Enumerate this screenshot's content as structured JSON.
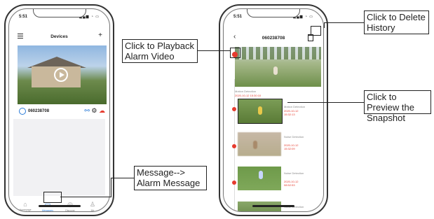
{
  "left_phone": {
    "status_time": "5:51",
    "title": "Devices",
    "device_id": "060238708",
    "tabs": [
      {
        "label": "Homepage",
        "icon": "home-icon"
      },
      {
        "label": "Messages",
        "icon": "message-icon"
      },
      {
        "label": "Discover",
        "icon": "compass-icon"
      },
      {
        "label": "Me",
        "icon": "user-icon"
      }
    ]
  },
  "right_phone": {
    "status_time": "5:51",
    "title": "060238708",
    "motion_label": "Motion Detection",
    "motion_time": "2020-10-12 15:30:10",
    "events": [
      {
        "type": "Motion Detection",
        "time": "2020-10-12 15:32:13"
      },
      {
        "type": "Noise Detection",
        "time": "2020-10-12 15:32:09"
      },
      {
        "type": "Noise Detection",
        "time": "2020-10-12 08:52:53"
      },
      {
        "type": "Noise Detection",
        "time": "2020-10-12"
      }
    ]
  },
  "callouts": {
    "playback": "Click to Playback Alarm Video",
    "delete": "Click to Delete History",
    "preview": "Click to Preview the Snapshot",
    "message": "Message--> Alarm Message"
  },
  "colors": {
    "accent": "#2a7bd8",
    "alarm": "#e63b2e"
  }
}
